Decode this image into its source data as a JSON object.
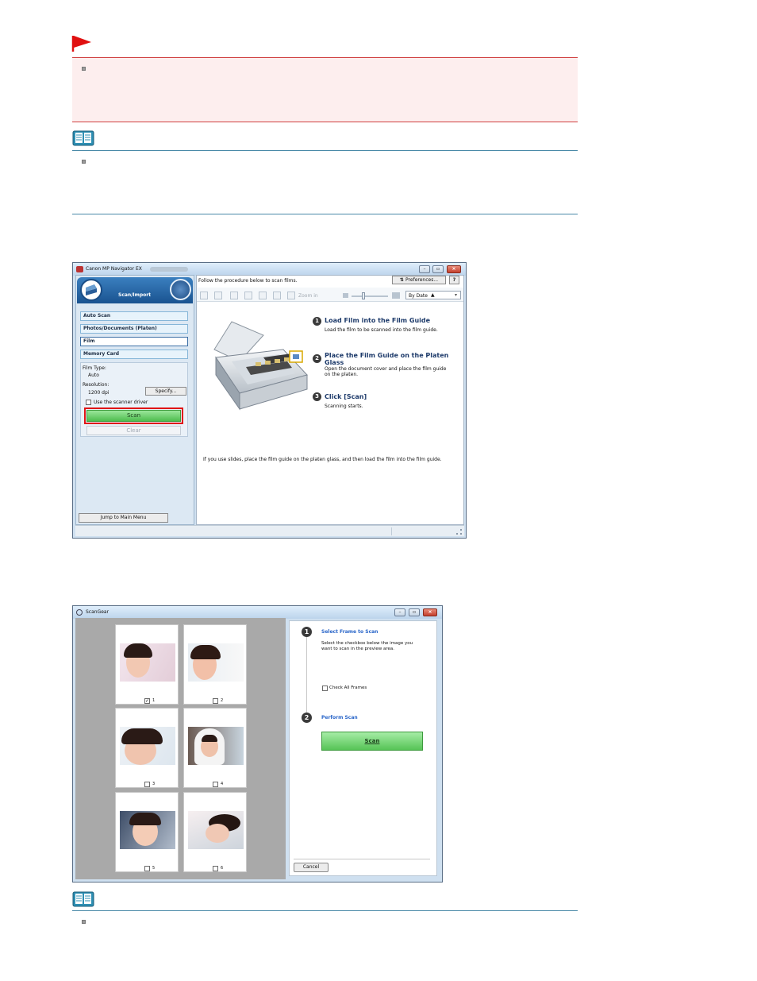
{
  "mp_navigator": {
    "title": "Canon MP Navigator EX",
    "title_blurred": "",
    "mode_label": "Scan/Import",
    "instruction": "Follow the procedure below to scan films.",
    "preferences_label": "Preferences...",
    "help_label": "?",
    "zoom_label": "Zoom in",
    "sort_label": "By Date",
    "tabs": [
      {
        "label": "Auto Scan"
      },
      {
        "label": "Photos/Documents (Platen)"
      },
      {
        "label": "Film"
      },
      {
        "label": "Memory Card"
      }
    ],
    "film_type_label": "Film Type:",
    "film_type_value": "Auto",
    "resolution_label": "Resolution:",
    "resolution_value": "1200 dpi",
    "specify_label": "Specify...",
    "use_driver_label": "Use the scanner driver",
    "scan_label": "Scan",
    "clear_label": "Clear",
    "jump_label": "Jump to Main Menu",
    "steps": [
      {
        "num": "1",
        "title": "Load Film into the Film Guide",
        "desc": "Load the film to be scanned into the film guide."
      },
      {
        "num": "2",
        "title": "Place the Film Guide on the Platen",
        "title2": "Glass",
        "desc": "Open the document cover and place the film guide",
        "desc2": "on the platen."
      },
      {
        "num": "3",
        "title": "Click [Scan]",
        "desc": "Scanning starts."
      }
    ],
    "slides_note": "If you use slides, place the film guide on the platen glass, and then load the film into the film guide."
  },
  "scangear": {
    "title": "ScanGear",
    "frames": [
      {
        "label": "1",
        "checked": true
      },
      {
        "label": "2",
        "checked": false
      },
      {
        "label": "3",
        "checked": false
      },
      {
        "label": "4",
        "checked": false
      },
      {
        "label": "5",
        "checked": false
      },
      {
        "label": "6",
        "checked": false
      }
    ],
    "step1_num": "1",
    "step1_title": "Select Frame to Scan",
    "step1_desc1": "Select the checkbox below the image you",
    "step1_desc2": "want to scan in the preview area.",
    "check_all_label": "Check All Frames",
    "step2_num": "2",
    "step2_title": "Perform Scan",
    "scan_label": "Scan",
    "cancel_label": "Cancel"
  },
  "colors": {
    "important_flag": "#e01010",
    "scan_green": "#7bd67b",
    "highlight_red": "#e01515",
    "step_blue": "#2a66c9"
  }
}
